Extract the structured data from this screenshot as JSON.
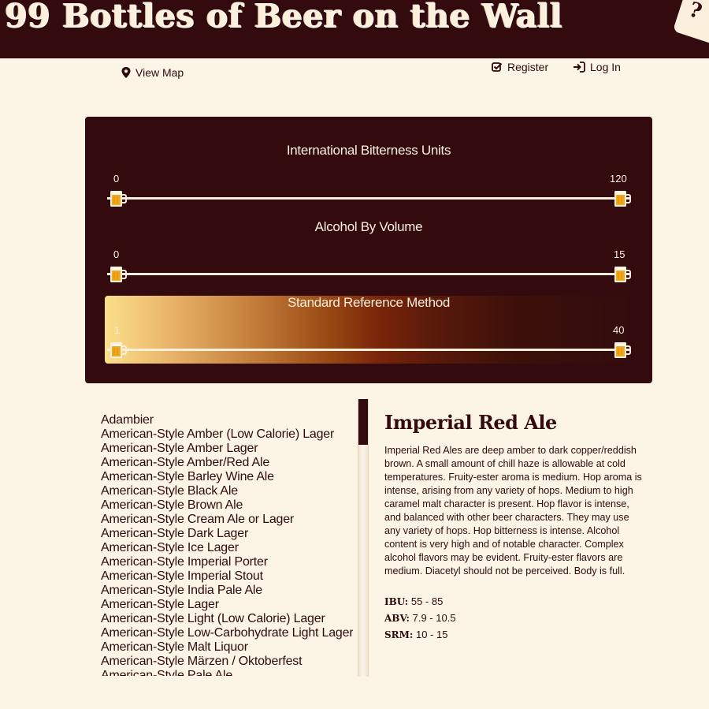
{
  "header": {
    "title": "99 Bottles of Beer on the Wall"
  },
  "nav": {
    "view_map": "View Map",
    "register": "Register",
    "login": "Log In"
  },
  "filters": {
    "ibu": {
      "title": "International Bitterness Units",
      "min": "0",
      "max": "120"
    },
    "abv": {
      "title": "Alcohol By Volume",
      "min": "0",
      "max": "15"
    },
    "srm": {
      "title": "Standard Reference Method",
      "min": "1",
      "max": "40"
    }
  },
  "styles": [
    "Adambier",
    "American-Style Amber (Low Calorie) Lager",
    "American-Style Amber Lager",
    "American-Style Amber/Red Ale",
    "American-Style Barley Wine Ale",
    "American-Style Black Ale",
    "American-Style Brown Ale",
    "American-Style Cream Ale or Lager",
    "American-Style Dark Lager",
    "American-Style Ice Lager",
    "American-Style Imperial Porter",
    "American-Style Imperial Stout",
    "American-Style India Pale Ale",
    "American-Style Lager",
    "American-Style Light (Low Calorie) Lager",
    "American-Style Low-Carbohydrate Light Lager",
    "American-Style Malt Liquor",
    "American-Style Märzen / Oktoberfest",
    "American-Style Pale Ale"
  ],
  "detail": {
    "name": "Imperial Red Ale",
    "description": "Imperial Red Ales are deep amber to dark copper/reddish brown. A small amount of chill haze is allowable at cold temperatures. Fruity-ester aroma is medium. Hop aroma is intense, arising from any variety of hops. Medium to high caramel malt character is present. Hop flavor is intense, and balanced with other beer characters. They may use any variety of hops. Hop bitterness is intense. Alcohol content is very high and of notable character. Complex alcohol flavors may be evident. Fruity-ester flavors are medium. Diacetyl should not be perceived. Body is full.",
    "ibu_label": "IBU:",
    "ibu": "55 - 85",
    "abv_label": "ABV:",
    "abv": "7.9 - 10.5",
    "srm_label": "SRM:",
    "srm": "10 - 15"
  }
}
